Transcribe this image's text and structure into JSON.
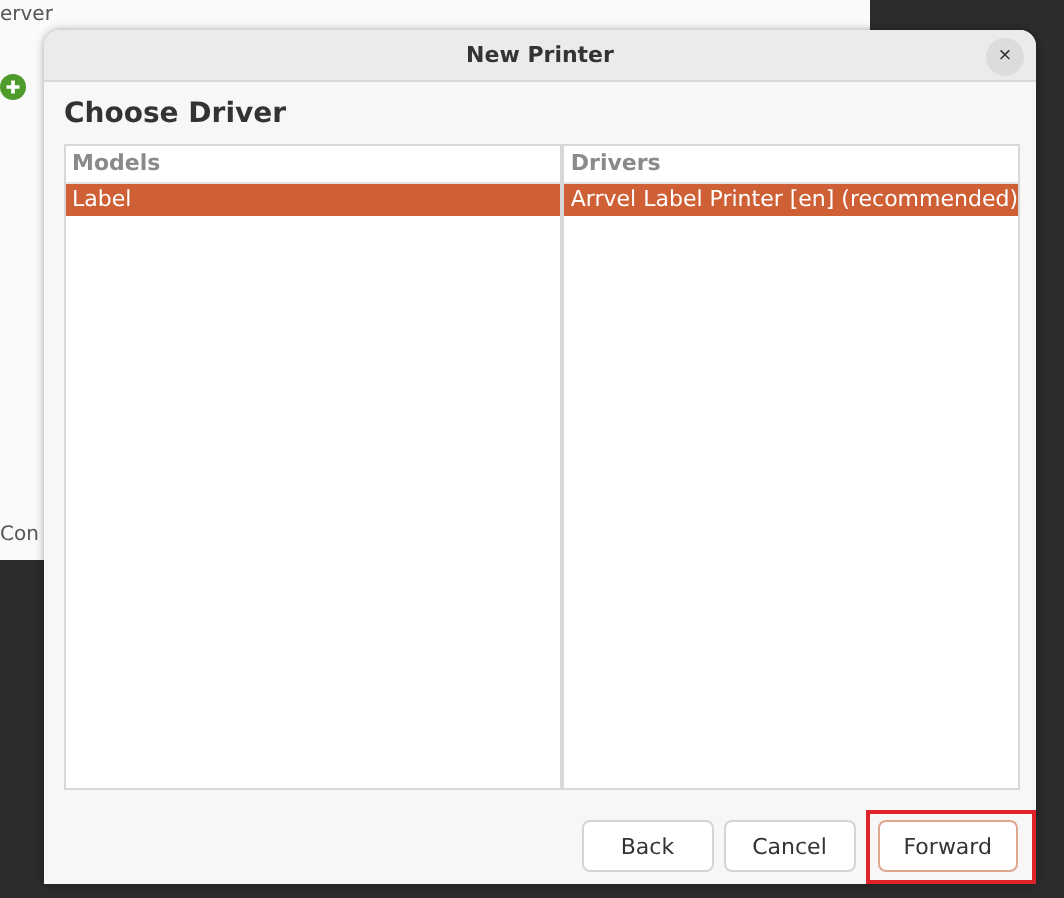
{
  "background_window": {
    "menu": [
      "erver"
    ],
    "status_text": "Con"
  },
  "dialog": {
    "title": "New Printer",
    "close": "×",
    "heading": "Choose Driver",
    "models": {
      "header": "Models",
      "items": [
        {
          "label": "Label",
          "selected": true
        }
      ]
    },
    "drivers": {
      "header": "Drivers",
      "items": [
        {
          "label": "Arrvel Label Printer [en] (recommended)",
          "selected": true
        }
      ]
    },
    "buttons": [
      {
        "label": "Back",
        "default": false,
        "highlighted": false
      },
      {
        "label": "Cancel",
        "default": false,
        "highlighted": false
      },
      {
        "label": "Forward",
        "default": true,
        "highlighted": true
      }
    ]
  }
}
